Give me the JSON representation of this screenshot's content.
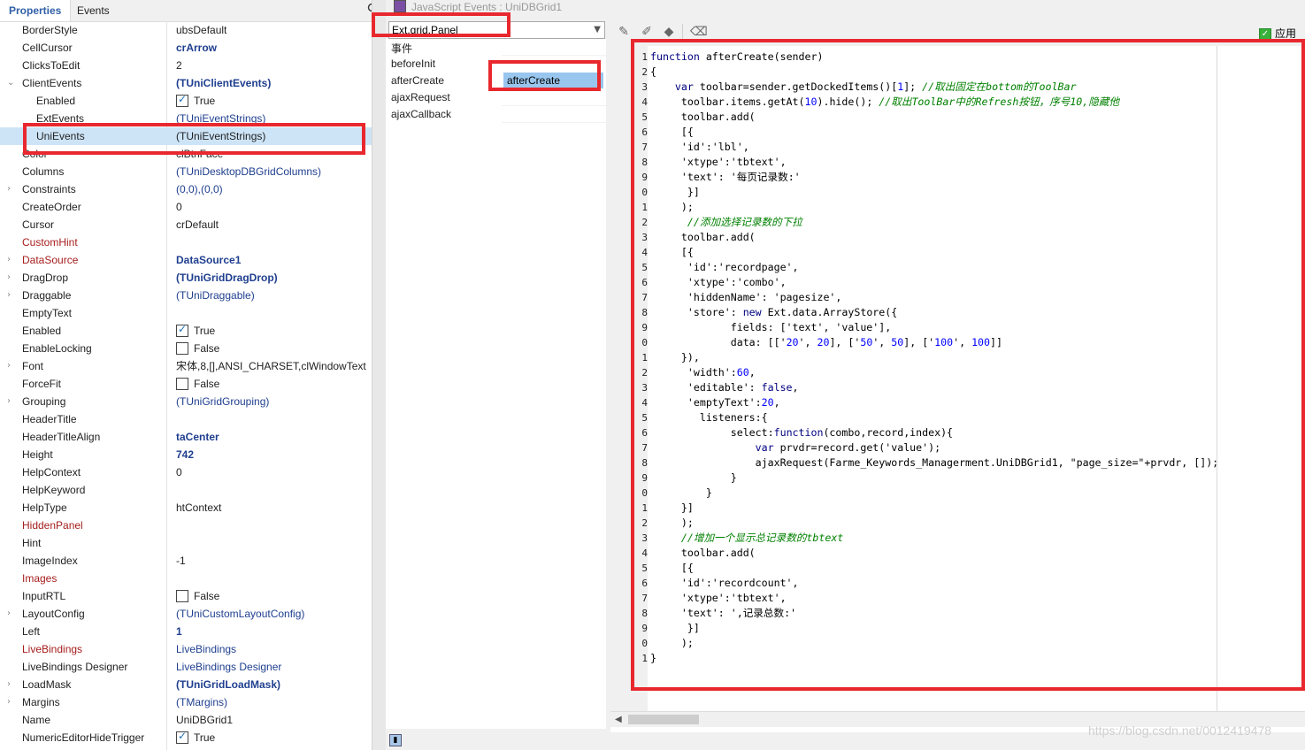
{
  "inspector": {
    "tabs": [
      "Properties",
      "Events"
    ],
    "properties": [
      {
        "name": "BorderStyle",
        "value": "ubsDefault"
      },
      {
        "name": "CellCursor",
        "value": "crArrow",
        "bold": true
      },
      {
        "name": "ClicksToEdit",
        "value": "2"
      },
      {
        "name": "ClientEvents",
        "value": "(TUniClientEvents)",
        "bold": true,
        "expanded": true
      },
      {
        "name": "Enabled",
        "value": "True",
        "check": true,
        "indent": true
      },
      {
        "name": "ExtEvents",
        "value": "(TUniEventStrings)",
        "indent": true,
        "blue": true
      },
      {
        "name": "UniEvents",
        "value": "(TUniEventStrings)",
        "indent": true,
        "selected": true
      },
      {
        "name": "Color",
        "value": "clBtnFace"
      },
      {
        "name": "Columns",
        "value": "(TUniDesktopDBGridColumns)",
        "blue": true
      },
      {
        "name": "Constraints",
        "value": "(0,0),(0,0)",
        "blue": true,
        "expander": true
      },
      {
        "name": "CreateOrder",
        "value": "0"
      },
      {
        "name": "Cursor",
        "value": "crDefault"
      },
      {
        "name": "CustomHint",
        "value": "",
        "red": true
      },
      {
        "name": "DataSource",
        "value": "DataSource1",
        "red": true,
        "bold": true,
        "expander": true
      },
      {
        "name": "DragDrop",
        "value": "(TUniGridDragDrop)",
        "bold": true,
        "expander": true
      },
      {
        "name": "Draggable",
        "value": "(TUniDraggable)",
        "blue": true,
        "expander": true
      },
      {
        "name": "EmptyText",
        "value": ""
      },
      {
        "name": "Enabled",
        "value": "True",
        "check": true
      },
      {
        "name": "EnableLocking",
        "value": "False",
        "check": false
      },
      {
        "name": "Font",
        "value": "宋体,8,[],ANSI_CHARSET,clWindowText",
        "expander": true
      },
      {
        "name": "ForceFit",
        "value": "False",
        "check": false
      },
      {
        "name": "Grouping",
        "value": "(TUniGridGrouping)",
        "blue": true,
        "expander": true
      },
      {
        "name": "HeaderTitle",
        "value": ""
      },
      {
        "name": "HeaderTitleAlign",
        "value": "taCenter",
        "bold": true
      },
      {
        "name": "Height",
        "value": "742",
        "bold": true
      },
      {
        "name": "HelpContext",
        "value": "0"
      },
      {
        "name": "HelpKeyword",
        "value": ""
      },
      {
        "name": "HelpType",
        "value": "htContext"
      },
      {
        "name": "HiddenPanel",
        "value": "",
        "red": true
      },
      {
        "name": "Hint",
        "value": ""
      },
      {
        "name": "ImageIndex",
        "value": "-1"
      },
      {
        "name": "Images",
        "value": "",
        "red": true
      },
      {
        "name": "InputRTL",
        "value": "False",
        "check": false
      },
      {
        "name": "LayoutConfig",
        "value": "(TUniCustomLayoutConfig)",
        "blue": true,
        "expander": true
      },
      {
        "name": "Left",
        "value": "1",
        "bold": true
      },
      {
        "name": "LiveBindings",
        "value": "LiveBindings",
        "red": true,
        "blue": true
      },
      {
        "name": "LiveBindings Designer",
        "value": "LiveBindings Designer",
        "blue": true
      },
      {
        "name": "LoadMask",
        "value": "(TUniGridLoadMask)",
        "bold": true,
        "expander": true
      },
      {
        "name": "Margins",
        "value": "(TMargins)",
        "blue": true,
        "expander": true
      },
      {
        "name": "Name",
        "value": "UniDBGrid1"
      },
      {
        "name": "NumericEditorHideTrigger",
        "value": "True",
        "check": true
      }
    ]
  },
  "dialog": {
    "title": "JavaScript Events : UniDBGrid1",
    "combo_value": "Ext.grid.Panel",
    "event_header": "事件",
    "events": [
      "beforeInit",
      "afterCreate",
      "ajaxRequest",
      "ajaxCallback"
    ],
    "selected_event": "afterCreate",
    "apply_label": "应用",
    "toolbar_icons": [
      "new-event-icon",
      "delete-event-icon",
      "clear-icon",
      "eraser-icon"
    ]
  },
  "code": {
    "line_numbers": [
      "1",
      "2",
      "3",
      "4",
      "5",
      "6",
      "7",
      "8",
      "9",
      "0",
      "1",
      "2",
      "3",
      "4",
      "5",
      "6",
      "7",
      "8",
      "9",
      "0",
      "1",
      "2",
      "3",
      "4",
      "5",
      "6",
      "7",
      "8",
      "9",
      "0",
      "1",
      "2",
      "3",
      "4",
      "5",
      "6",
      "7",
      "8",
      "9",
      "0",
      "1"
    ],
    "lines": [
      "function afterCreate(sender)",
      "{",
      "    var toolbar=sender.getDockedItems()[1]; //取出固定在bottom的ToolBar",
      "     toolbar.items.getAt(10).hide(); //取出ToolBar中的Refresh按钮，序号10,隐藏他",
      "     toolbar.add(",
      "     [{",
      "     'id':'lbl',",
      "     'xtype':'tbtext',",
      "     'text': '每页记录数:'",
      "      }]",
      "     );",
      "      //添加选择记录数的下拉",
      "     toolbar.add(",
      "     [{",
      "      'id':'recordpage',",
      "      'xtype':'combo',",
      "      'hiddenName': 'pagesize',",
      "      'store': new Ext.data.ArrayStore({",
      "             fields: ['text', 'value'],",
      "             data: [['20', 20], ['50', 50], ['100', 100]]",
      "     }),",
      "      'width':60,",
      "      'editable': false,",
      "      'emptyText':20,",
      "        listeners:{",
      "             select:function(combo,record,index){",
      "                 var prvdr=record.get('value');",
      "                 ajaxRequest(Farme_Keywords_Managerment.UniDBGrid1, \"page_size=\"+prvdr, []);",
      "             }",
      "         }",
      "     }]",
      "     );",
      "     //增加一个显示总记录数的tbtext",
      "     toolbar.add(",
      "     [{",
      "     'id':'recordcount',",
      "     'xtype':'tbtext',",
      "     'text': ',记录总数:'",
      "      }]",
      "     );",
      "}"
    ]
  },
  "watermark": "https://blog.csdn.net/0012419478"
}
